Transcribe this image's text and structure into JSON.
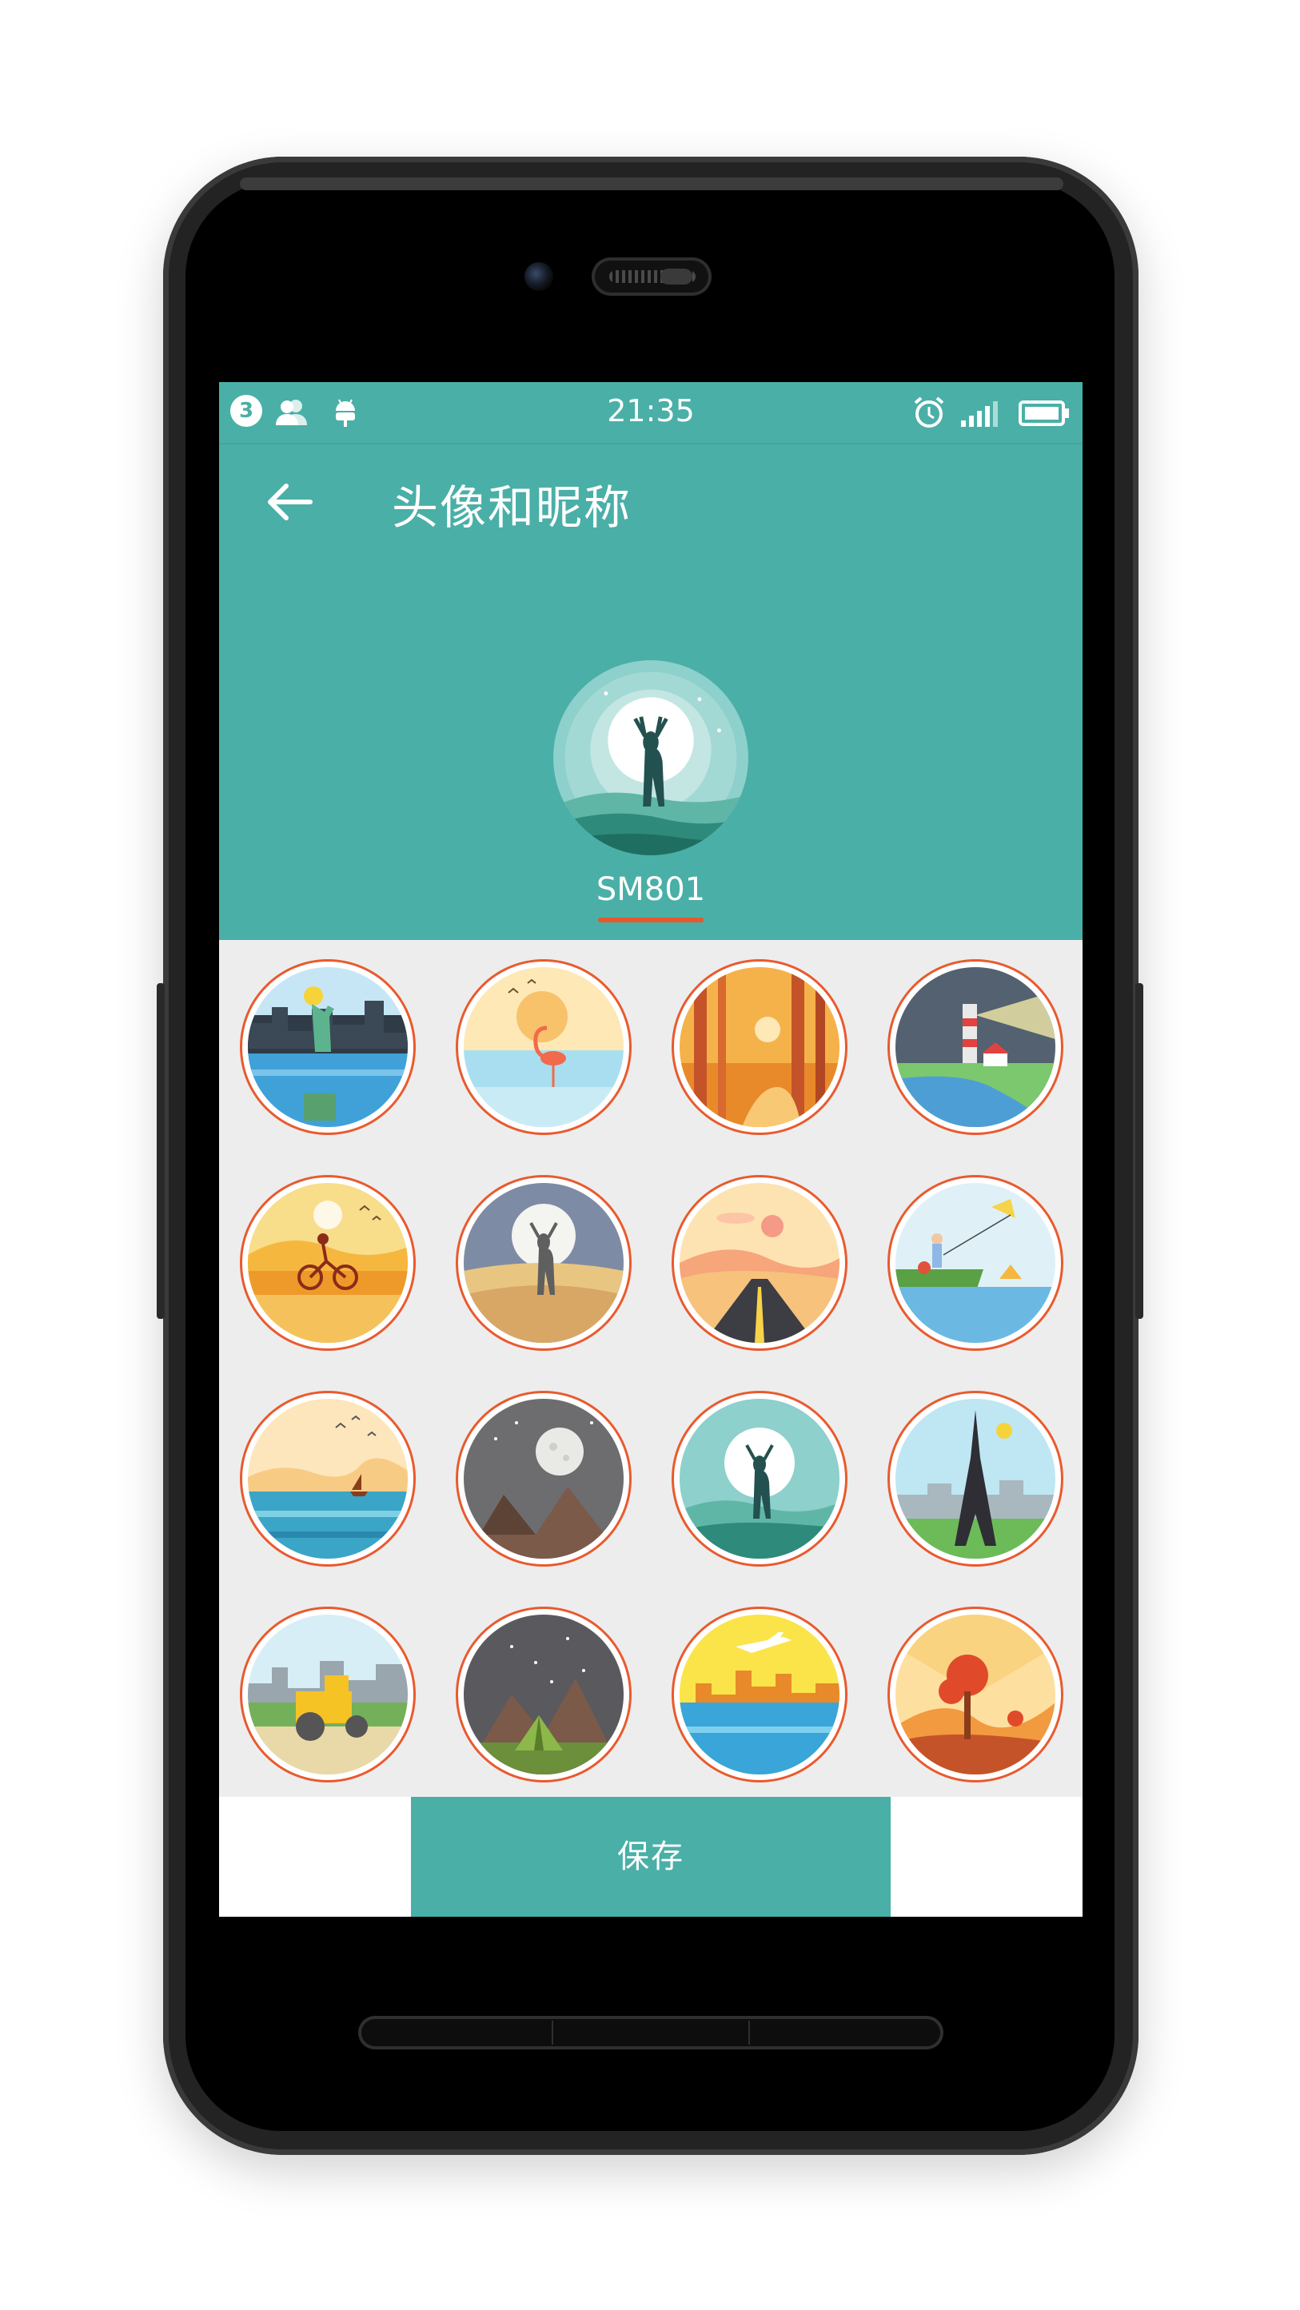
{
  "status_bar": {
    "notification_count": "3",
    "time": "21:35"
  },
  "header": {
    "title": "头像和昵称",
    "nickname": "SM801"
  },
  "avatars": [
    {
      "name": "statue-of-liberty",
      "selected": false
    },
    {
      "name": "flamingo",
      "selected": false
    },
    {
      "name": "autumn-forest",
      "selected": false
    },
    {
      "name": "lighthouse",
      "selected": false
    },
    {
      "name": "cyclist-sunset",
      "selected": false
    },
    {
      "name": "deer-dusk",
      "selected": false
    },
    {
      "name": "road-sunset",
      "selected": false
    },
    {
      "name": "kite-lake",
      "selected": false
    },
    {
      "name": "sea-birds",
      "selected": false
    },
    {
      "name": "moon-mountains",
      "selected": false
    },
    {
      "name": "deer-moon",
      "selected": true
    },
    {
      "name": "eiffel-tower",
      "selected": false
    },
    {
      "name": "road-roller",
      "selected": false
    },
    {
      "name": "camping-night",
      "selected": false
    },
    {
      "name": "airplane-city",
      "selected": false
    },
    {
      "name": "autumn-tree",
      "selected": false
    }
  ],
  "footer": {
    "save_label": "保存"
  },
  "colors": {
    "primary": "#4aafa7",
    "accent": "#e95a2e",
    "background": "#ededed"
  }
}
